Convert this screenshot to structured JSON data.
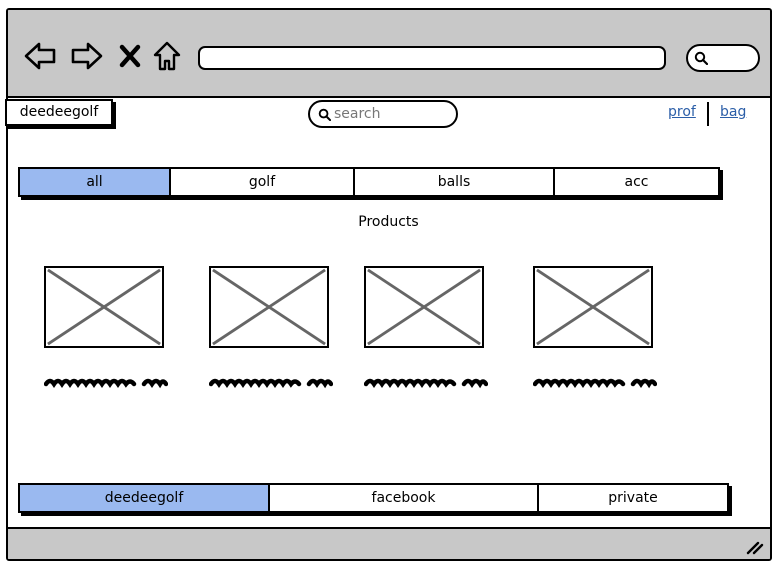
{
  "browser": {
    "nav_icons": [
      "back-arrow-icon",
      "forward-arrow-icon",
      "close-icon",
      "home-icon"
    ],
    "url_value": "",
    "search_icon": "search-icon"
  },
  "header": {
    "logo": "deedeegolf",
    "search_placeholder": "search",
    "links": [
      {
        "label": "prof"
      },
      {
        "label": "bag"
      }
    ],
    "link_color": "#2b5ea8"
  },
  "tabs": [
    {
      "label": "all",
      "selected": true
    },
    {
      "label": "golf",
      "selected": false
    },
    {
      "label": "balls",
      "selected": false
    },
    {
      "label": "acc",
      "selected": false
    }
  ],
  "products": {
    "title": "Products",
    "items": [
      {
        "image_icon": "image-placeholder-icon"
      },
      {
        "image_icon": "image-placeholder-icon"
      },
      {
        "image_icon": "image-placeholder-icon"
      },
      {
        "image_icon": "image-placeholder-icon"
      }
    ]
  },
  "footer": {
    "items": [
      {
        "label": "deedeegolf",
        "selected": true
      },
      {
        "label": "facebook",
        "selected": false
      },
      {
        "label": "private",
        "selected": false
      }
    ]
  },
  "colors": {
    "selected_tab": "#9ab9f0",
    "chrome": "#c8c8c8"
  }
}
